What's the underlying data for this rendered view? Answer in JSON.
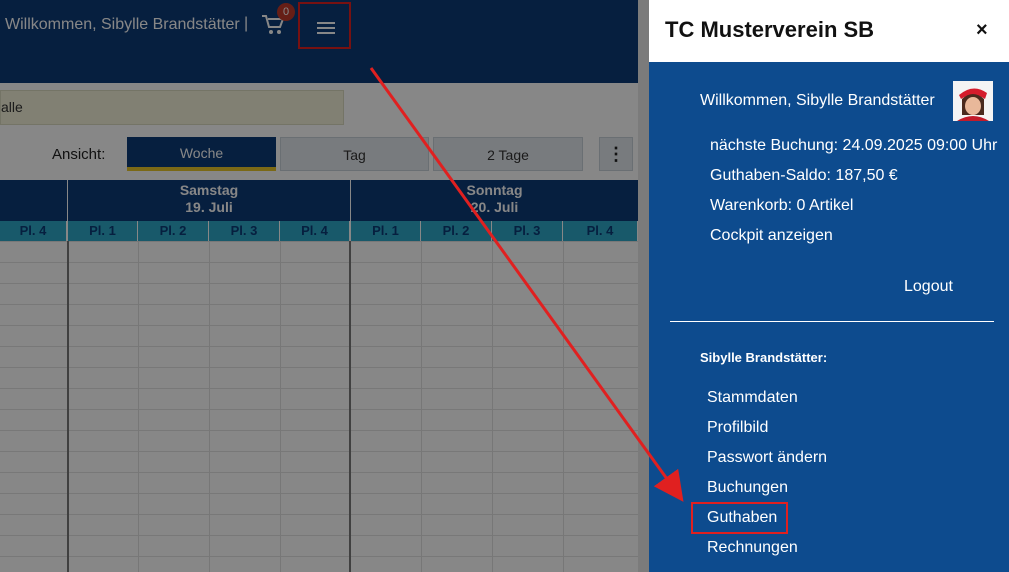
{
  "app": {
    "welcome": "Willkommen, Sibylle Brandstätter",
    "separator": "|",
    "cart_count": "0",
    "cart_icon": "cart-icon",
    "menu_icon": "hamburger-menu-icon",
    "filter_text": "alle",
    "view_label": "Ansicht:",
    "views": [
      "Woche",
      "Tag",
      "2 Tage"
    ],
    "more_icon": "more-vertical-icon",
    "days": [
      {
        "name": "",
        "date": ""
      },
      {
        "name": "Samstag",
        "date": "19. Juli"
      },
      {
        "name": "Sonntag",
        "date": "20. Juli"
      }
    ],
    "courts": [
      "Pl. 4",
      "Pl. 1",
      "Pl. 2",
      "Pl. 3",
      "Pl. 4",
      "Pl. 1",
      "Pl. 2",
      "Pl. 3",
      "Pl. 4"
    ]
  },
  "drawer": {
    "title": "TC Musterverein SB",
    "close": "×",
    "welcome": "Willkommen, Sibylle Brandstätter",
    "next_booking": "nächste Buchung: 24.09.2025 09:00 Uhr",
    "balance": "Guthaben-Saldo: 187,50 €",
    "cart": "Warenkorb: 0 Artikel",
    "cockpit": "Cockpit anzeigen",
    "logout": "Logout",
    "section_title": "Sibylle Brandstätter:",
    "menu": [
      "Stammdaten",
      "Profilbild",
      "Passwort ändern",
      "Buchungen",
      "Guthaben",
      "Rechnungen"
    ]
  },
  "colors": {
    "navy": "#0d3b78",
    "drawer_blue": "#0d4b8e",
    "court_cyan": "#2ea9c9",
    "annotation_red": "#e02020",
    "active_underline": "#e8c72b"
  }
}
